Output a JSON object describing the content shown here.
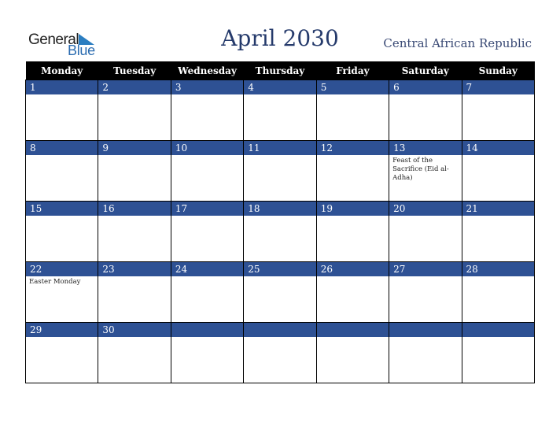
{
  "logo": {
    "line1": "General",
    "line2": "Blue"
  },
  "title": "April 2030",
  "country": "Central African Republic",
  "weekdays": [
    "Monday",
    "Tuesday",
    "Wednesday",
    "Thursday",
    "Friday",
    "Saturday",
    "Sunday"
  ],
  "weeks": [
    [
      {
        "day": "1",
        "event": ""
      },
      {
        "day": "2",
        "event": ""
      },
      {
        "day": "3",
        "event": ""
      },
      {
        "day": "4",
        "event": ""
      },
      {
        "day": "5",
        "event": ""
      },
      {
        "day": "6",
        "event": ""
      },
      {
        "day": "7",
        "event": ""
      }
    ],
    [
      {
        "day": "8",
        "event": ""
      },
      {
        "day": "9",
        "event": ""
      },
      {
        "day": "10",
        "event": ""
      },
      {
        "day": "11",
        "event": ""
      },
      {
        "day": "12",
        "event": ""
      },
      {
        "day": "13",
        "event": "Feast of the Sacrifice (Eid al-Adha)"
      },
      {
        "day": "14",
        "event": ""
      }
    ],
    [
      {
        "day": "15",
        "event": ""
      },
      {
        "day": "16",
        "event": ""
      },
      {
        "day": "17",
        "event": ""
      },
      {
        "day": "18",
        "event": ""
      },
      {
        "day": "19",
        "event": ""
      },
      {
        "day": "20",
        "event": ""
      },
      {
        "day": "21",
        "event": ""
      }
    ],
    [
      {
        "day": "22",
        "event": "Easter Monday"
      },
      {
        "day": "23",
        "event": ""
      },
      {
        "day": "24",
        "event": ""
      },
      {
        "day": "25",
        "event": ""
      },
      {
        "day": "26",
        "event": ""
      },
      {
        "day": "27",
        "event": ""
      },
      {
        "day": "28",
        "event": ""
      }
    ],
    [
      {
        "day": "29",
        "event": ""
      },
      {
        "day": "30",
        "event": ""
      },
      {
        "day": "",
        "event": ""
      },
      {
        "day": "",
        "event": ""
      },
      {
        "day": "",
        "event": ""
      },
      {
        "day": "",
        "event": ""
      },
      {
        "day": "",
        "event": ""
      }
    ]
  ],
  "colors": {
    "header_bg": "#000000",
    "daynum_bg": "#2e5194",
    "title": "#253a6b"
  }
}
